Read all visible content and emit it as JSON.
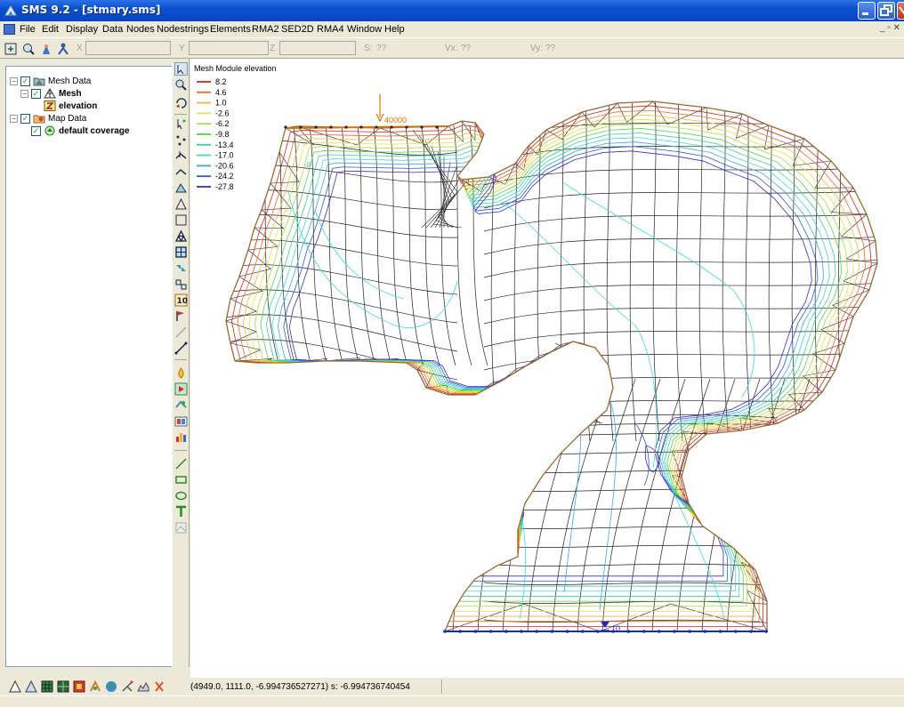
{
  "window": {
    "title": "SMS 9.2 - [stmary.sms]"
  },
  "menu": [
    "File",
    "Edit",
    "Display",
    "Data",
    "Nodes",
    "Nodestrings",
    "Elements",
    "RMA2",
    "SED2D",
    "RMA4",
    "Window",
    "Help"
  ],
  "coords": {
    "x_label": "X",
    "y_label": "Y",
    "z_label": "Z",
    "s_label": "S:",
    "s_value": "??",
    "vx_label": "Vx:",
    "vx_value": "??",
    "vy_label": "Vy:",
    "vy_value": "??"
  },
  "tree": {
    "mesh_data": "Mesh Data",
    "mesh": "Mesh",
    "elevation": "elevation",
    "map_data": "Map Data",
    "default_coverage": "default coverage"
  },
  "legend": {
    "title": "Mesh Module elevation",
    "entries": [
      {
        "label": "8.2",
        "color": "#e0201a"
      },
      {
        "label": "4.6",
        "color": "#f06a20"
      },
      {
        "label": "1.0",
        "color": "#f5b43a"
      },
      {
        "label": "-2.6",
        "color": "#e6e23a"
      },
      {
        "label": "-6.2",
        "color": "#a8dc3a"
      },
      {
        "label": "-9.8",
        "color": "#5ad04a"
      },
      {
        "label": "-13.4",
        "color": "#3ad29a"
      },
      {
        "label": "-17.0",
        "color": "#3adcd2"
      },
      {
        "label": "-20.6",
        "color": "#3aa8e0"
      },
      {
        "label": "-24.2",
        "color": "#2a5ad8"
      },
      {
        "label": "-27.8",
        "color": "#3a2ad0"
      }
    ]
  },
  "annotations": {
    "top_nodestring": "40000",
    "bottom_nodestring": "10",
    "contour_label": "-8"
  },
  "status": {
    "text": "(4949.0, 1111.0, -6.994736527271) s: -6.994736740454"
  }
}
